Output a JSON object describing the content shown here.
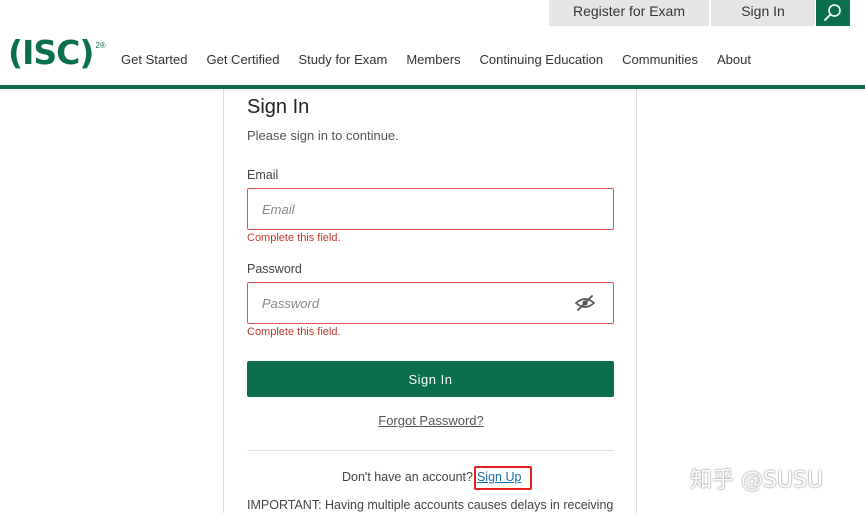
{
  "header": {
    "register_label": "Register for Exam",
    "signin_label": "Sign In",
    "search_icon": "search-icon",
    "logo_text": "(ISC)",
    "logo_sup": "2®",
    "brand_color": "#0b6e4f"
  },
  "nav": {
    "items": [
      "Get Started",
      "Get Certified",
      "Study for Exam",
      "Members",
      "Continuing Education",
      "Communities",
      "About"
    ]
  },
  "form": {
    "title": "Sign In",
    "subtitle": "Please sign in to continue.",
    "email_label": "Email",
    "email_placeholder": "Email",
    "email_error": "Complete this field.",
    "password_label": "Password",
    "password_placeholder": "Password",
    "password_error": "Complete this field.",
    "password_toggle_icon": "eye-slash-icon",
    "submit_label": "Sign In",
    "forgot_label": "Forgot Password?",
    "signup_prompt": "Don't have an account?",
    "signup_label": "Sign Up",
    "important_text": "IMPORTANT: Having multiple accounts causes delays in receiving",
    "error_color": "#c0392b"
  },
  "watermark": {
    "text": "知乎 @SUSU"
  }
}
